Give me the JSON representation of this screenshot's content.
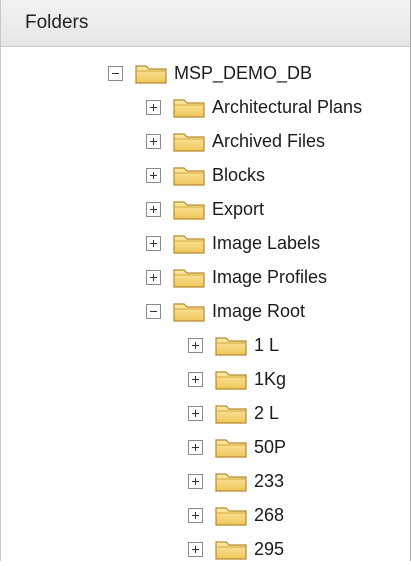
{
  "panel": {
    "title": "Folders"
  },
  "tree": {
    "root": {
      "label": "MSP_DEMO_DB",
      "expanded": true,
      "icon": "folder-icon"
    },
    "children": [
      {
        "label": "Architectural Plans",
        "expanded": false,
        "icon": "folder-icon"
      },
      {
        "label": "Archived Files",
        "expanded": false,
        "icon": "folder-icon"
      },
      {
        "label": "Blocks",
        "expanded": false,
        "icon": "folder-icon"
      },
      {
        "label": "Export",
        "expanded": false,
        "icon": "folder-icon"
      },
      {
        "label": "Image Labels",
        "expanded": false,
        "icon": "folder-icon"
      },
      {
        "label": "Image Profiles",
        "expanded": false,
        "icon": "folder-icon"
      },
      {
        "label": "Image Root",
        "expanded": true,
        "icon": "folder-icon",
        "children": [
          {
            "label": "1 L",
            "expanded": false,
            "icon": "folder-icon"
          },
          {
            "label": "1Kg",
            "expanded": false,
            "icon": "folder-icon"
          },
          {
            "label": "2 L",
            "expanded": false,
            "icon": "folder-icon"
          },
          {
            "label": "50P",
            "expanded": false,
            "icon": "folder-icon"
          },
          {
            "label": "233",
            "expanded": false,
            "icon": "folder-icon"
          },
          {
            "label": "268",
            "expanded": false,
            "icon": "folder-icon"
          },
          {
            "label": "295",
            "expanded": false,
            "icon": "folder-icon"
          }
        ]
      }
    ]
  },
  "colors": {
    "folder_fill": "#f7d77f",
    "folder_stroke": "#b68a2c",
    "header_bg": "#eeeeee"
  }
}
